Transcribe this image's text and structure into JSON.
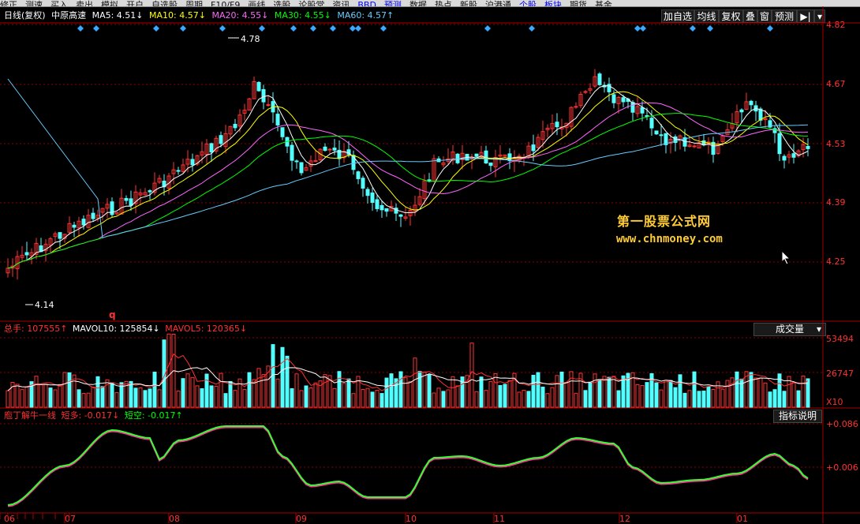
{
  "toolbar": {
    "items": [
      "修正",
      "测速",
      "买入",
      "卖出",
      "模拟",
      "开户",
      "自选股",
      "周期",
      "F10/F9",
      "画线",
      "选股",
      "论股堂",
      "资讯",
      "BBD",
      "预测",
      "数据",
      "热点",
      "新股",
      "沪港通",
      "个股",
      "板块",
      "期货",
      "基金"
    ]
  },
  "main_info": {
    "period": "日线(复权)",
    "stock_name": "中原高速",
    "ma5": "MA5: 4.51↓",
    "ma10": "MA10: 4.57↓",
    "ma20": "MA20: 4.55↓",
    "ma30": "MA30: 4.55↓",
    "ma60": "MA60: 4.57↑"
  },
  "main_buttons": {
    "add_watch": "加自选",
    "ma_line": "均线",
    "restore": "复权",
    "overlay": "叠",
    "window": "窗",
    "forecast": "预测",
    "next": "▶|",
    "menu": "▾"
  },
  "price_axis": [
    "4.82",
    "4.67",
    "4.53",
    "4.39",
    "4.25"
  ],
  "annotations": {
    "high": "4.78",
    "low": "4.14",
    "marker": "q"
  },
  "watermark": {
    "line1": "第一股票公式网",
    "line2": "www.chnmoney.com"
  },
  "volume_info": {
    "total": "总手: 107555↑",
    "mavol10": "MAVOL10: 125854↓",
    "mavol5": "MAVOL5: 120365↓"
  },
  "volume_dropdown": "成交量",
  "volume_axis": [
    "53494",
    "26747"
  ],
  "volume_unit": "X10",
  "indicator_info": {
    "name": "庖丁解牛一线",
    "short_long": "短多: -0.017↓",
    "short_short": "短空: -0.017↑"
  },
  "indicator_button": "指标说明",
  "indicator_axis": [
    "+0.086",
    "+0.006"
  ],
  "dates": [
    "06",
    "07",
    "08",
    "09",
    "10",
    "11",
    "12",
    "01"
  ],
  "colors": {
    "up": "#ff3232",
    "down": "#54ffff",
    "ma5": "#ffffff",
    "ma10": "#ffff00",
    "ma20": "#ff66ff",
    "ma30": "#00ff00",
    "ma60": "#66ccff",
    "grid": "#8b0000"
  }
}
